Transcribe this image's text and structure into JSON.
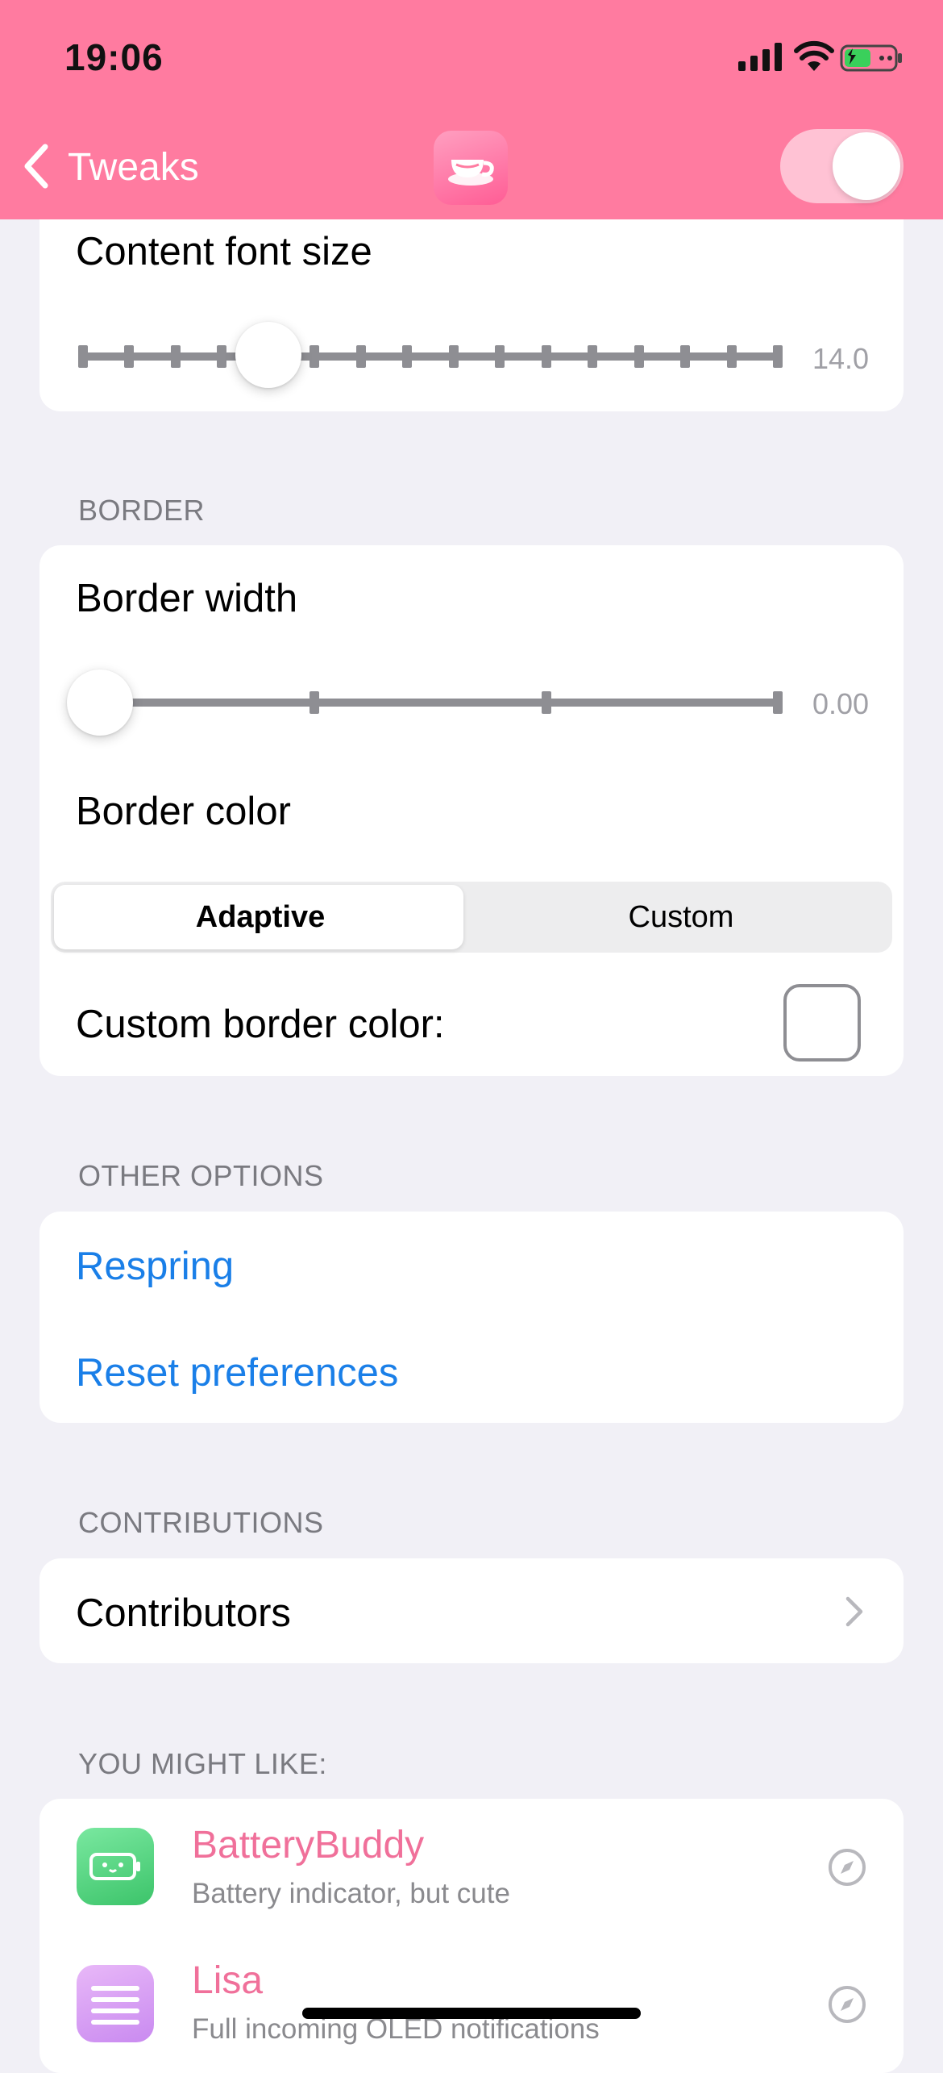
{
  "status_bar": {
    "time": "19:06"
  },
  "nav": {
    "back_label": "Tweaks",
    "enabled": true
  },
  "font_section": {
    "row_label": "Content font size",
    "value_label": "14.0",
    "slider_fraction": 0.27,
    "tick_count": 16
  },
  "border_section": {
    "header": "BORDER",
    "width_label": "Border width",
    "width_value_label": "0.00",
    "width_slider_fraction": 0.0,
    "width_tick_count": 4,
    "color_label": "Border color",
    "segments": [
      "Adaptive",
      "Custom"
    ],
    "selected_segment": "Adaptive",
    "custom_color_label": "Custom border color:"
  },
  "other_section": {
    "header": "OTHER OPTIONS",
    "respring": "Respring",
    "reset": "Reset preferences"
  },
  "contrib_section": {
    "header": "CONTRIBUTIONS",
    "contributors": "Contributors"
  },
  "recommend_section": {
    "header": "YOU MIGHT LIKE:",
    "items": [
      {
        "title": "BatteryBuddy",
        "subtitle": "Battery indicator, but cute",
        "icon": "battery-face-icon",
        "color": "#5fd98a"
      },
      {
        "title": "Lisa",
        "subtitle": "Full incoming OLED notifications",
        "icon": "lines-icon",
        "color": "#d89ef0"
      }
    ]
  },
  "colors": {
    "header_bg": "#ff7ba0",
    "link": "#1a7fe8",
    "recommend_title": "#f0709a"
  }
}
